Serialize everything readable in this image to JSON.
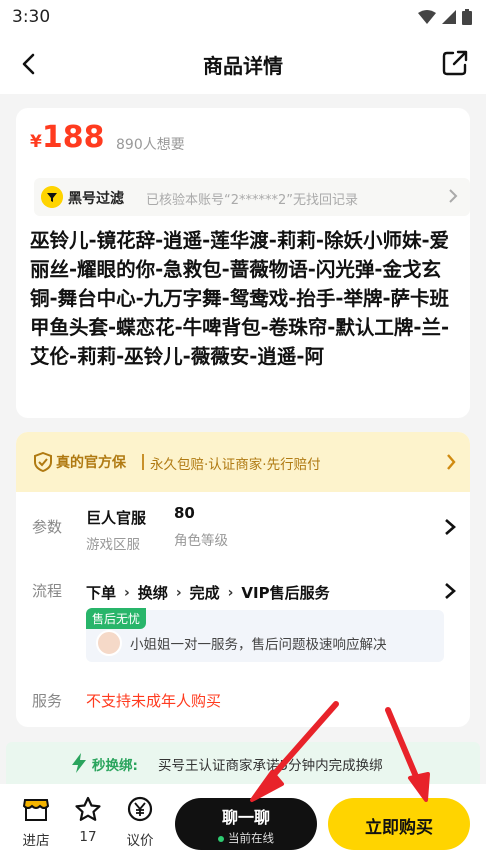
{
  "status_bar": {
    "time": "3:30"
  },
  "header": {
    "title": "商品详情"
  },
  "product": {
    "currency": "¥",
    "price": "188",
    "wants": "890人想要",
    "blacklist_label": "黑号过滤",
    "blacklist_text": "已核验本账号“2******2”无找回记录",
    "description": "巫铃儿-镜花辞-逍遥-莲华渡-莉莉-除妖小师妹-爱丽丝-耀眼的你-急救包-蔷薇物语-闪光弹-金戈玄铜-舞台中心-九万字舞-鸳鸯戏-抬手-举牌-萨卡班甲鱼头套-蝶恋花-牛啤背包-卷珠帘-默认工牌-兰-艾伦-莉莉-巫铃儿-薇薇安-逍遥-阿"
  },
  "guarantee": {
    "label": "真的官方保",
    "text": "永久包赔·认证商家·先行赔付"
  },
  "params": {
    "label": "参数",
    "server": "巨人官服",
    "server_sub": "游戏区服",
    "level": "80",
    "level_sub": "角色等级"
  },
  "process": {
    "label": "流程",
    "steps": [
      "下单",
      "换绑",
      "完成",
      "VIP售后服务"
    ],
    "tag": "售后无忧",
    "service_text": "小姐姐一对一服务，售后问题极速响应解决"
  },
  "service": {
    "label": "服务",
    "text": "不支持未成年人购买"
  },
  "swap_banner": {
    "label": "秒换绑:",
    "text": "买号王认证商家承诺5分钟内完成换绑"
  },
  "bottom_bar": {
    "store": "进店",
    "favorites": "17",
    "bargain": "议价",
    "chat": "聊一聊",
    "chat_status": "当前在线",
    "buy": "立即购买"
  },
  "colors": {
    "price": "#ff3b1f",
    "accent_yellow": "#ffd400",
    "guarantee_bg": "#fdf3cc",
    "service_green": "#28b56a",
    "annotation_arrow": "#e8232a"
  }
}
